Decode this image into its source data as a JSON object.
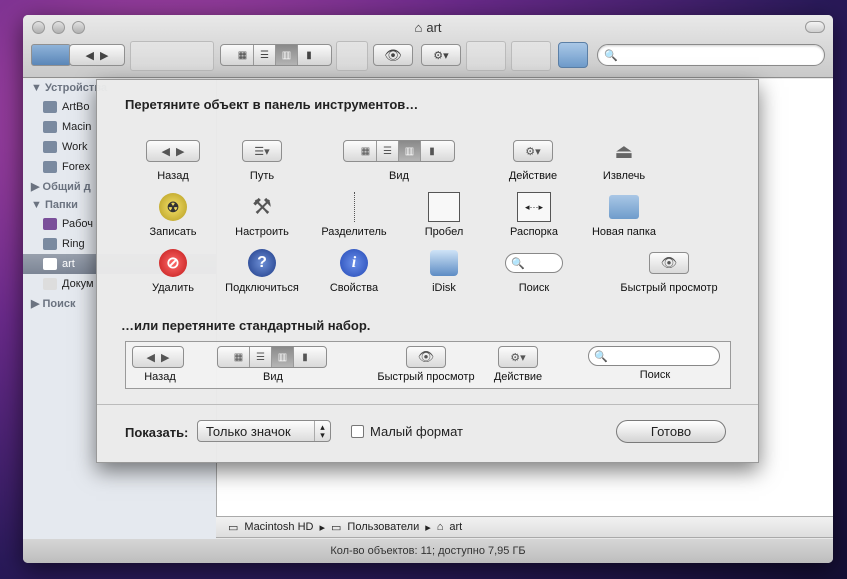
{
  "window": {
    "title": "art"
  },
  "sidebar": {
    "sections": [
      {
        "label": "Устройства",
        "items": [
          "ArtBo",
          "Macin",
          "Work",
          "Forex"
        ]
      },
      {
        "label": "Общий д",
        "items": []
      },
      {
        "label": "Папки",
        "items": [
          "Рабоч",
          "Ring",
          "art",
          "Докум"
        ]
      },
      {
        "label": "Поиск",
        "items": []
      }
    ],
    "selected": "art"
  },
  "sheet": {
    "title": "Перетяните объект в панель инструментов…",
    "items": [
      "Назад",
      "Путь",
      "Вид",
      "Действие",
      "Извлечь",
      "Записать",
      "Настроить",
      "Разделитель",
      "Пробел",
      "Распорка",
      "Новая папка",
      "Удалить",
      "Подключиться",
      "Свойства",
      "iDisk",
      "Поиск",
      "Быстрый просмотр"
    ],
    "subtitle": "…или перетяните стандартный набор.",
    "default_set": [
      "Назад",
      "Вид",
      "Быстрый просмотр",
      "Действие",
      "Поиск"
    ],
    "show_label": "Показать:",
    "show_value": "Только значок",
    "small_size_label": "Малый формат",
    "done_label": "Готово"
  },
  "pathbar": [
    "Macintosh HD",
    "Пользователи",
    "art"
  ],
  "status": "Кол-во объектов: 11; доступно 7,95 ГБ"
}
